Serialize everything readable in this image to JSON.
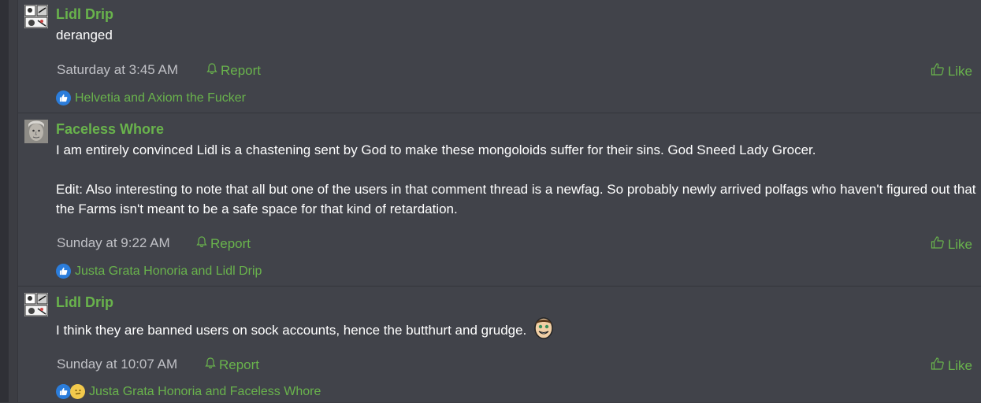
{
  "posts": [
    {
      "author": "Lidl Drip",
      "body": [
        "deranged"
      ],
      "time": "Saturday at 3:45 AM",
      "report_label": "Report",
      "like_label": "Like",
      "reactions_text": "Helvetia and Axiom the Fucker",
      "avatar": "manga-panel-avatar"
    },
    {
      "author": "Faceless Whore",
      "body": [
        "I am entirely convinced Lidl is a chastening sent by God to make these mongoloids suffer for their sins. God Sneed Lady Grocer.",
        "Edit: Also interesting to note that all but one of the users in that comment thread is a newfag. So probably newly arrived polfags who haven't figured out that the Farms isn't meant to be a safe space for that kind of retardation."
      ],
      "time": "Sunday at 9:22 AM",
      "report_label": "Report",
      "like_label": "Like",
      "reactions_text": "Justa Grata Honoria and Lidl Drip",
      "avatar": "portrait-photo-avatar"
    },
    {
      "author": "Lidl Drip",
      "body": [
        "I think they are banned users on sock accounts, hence the butthurt and grudge."
      ],
      "time": "Sunday at 10:07 AM",
      "report_label": "Report",
      "like_label": "Like",
      "reactions_text": "Justa Grata Honoria and Faceless Whore",
      "avatar": "manga-panel-avatar"
    }
  ],
  "icons": {
    "report": "bell-icon",
    "like": "thumbs-up-outline-icon",
    "reaction_like": "thumbs-up-reaction-icon",
    "reaction_think": "thinking-reaction-icon",
    "smiley": "smiley-face-emoji"
  },
  "colors": {
    "background": "#41434a",
    "accent": "#69b34c",
    "text": "#ffffff",
    "muted": "#c0c1c6",
    "reaction_blue": "#2b7ddb"
  }
}
